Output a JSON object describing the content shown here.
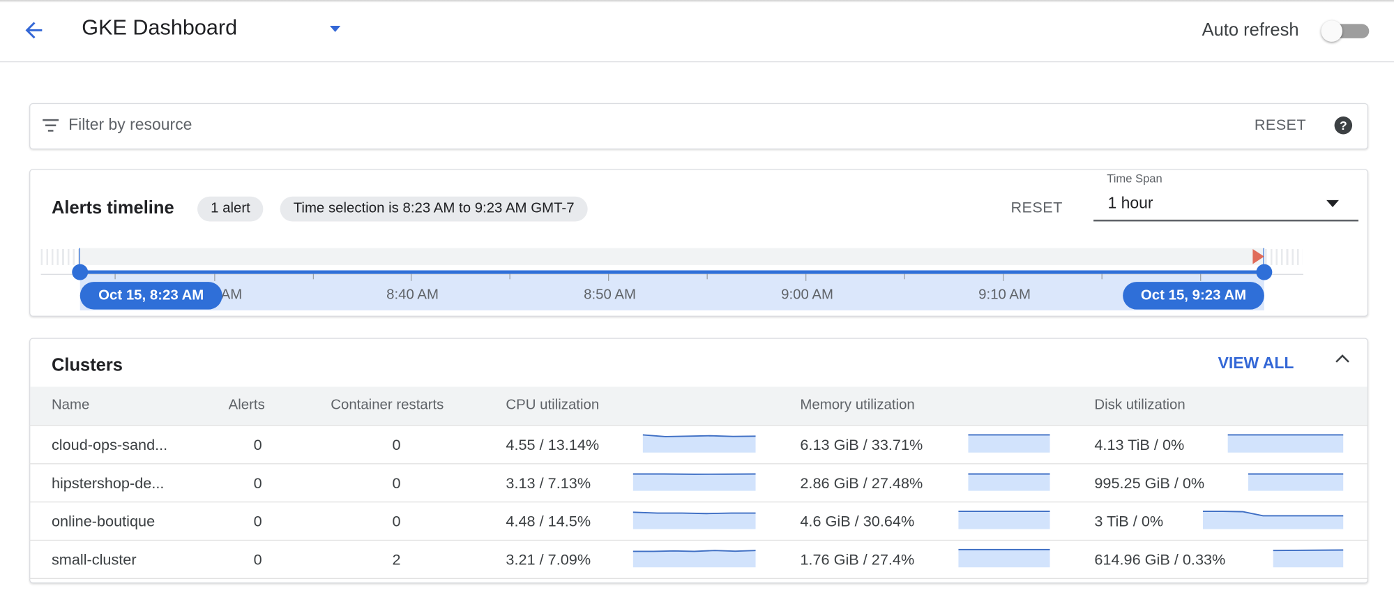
{
  "header": {
    "title": "GKE Dashboard",
    "auto_refresh_label": "Auto refresh",
    "auto_refresh_on": false
  },
  "filter": {
    "placeholder": "Filter by resource",
    "reset_label": "RESET",
    "icons": [
      "filter-icon",
      "help-icon"
    ]
  },
  "alerts_timeline": {
    "title": "Alerts timeline",
    "alert_count_chip": "1 alert",
    "time_selection_chip": "Time selection is 8:23 AM to 9:23 AM GMT-7",
    "reset_label": "RESET",
    "time_span": {
      "label": "Time Span",
      "value": "1 hour"
    },
    "axis_labels": [
      "8:30 AM",
      "8:40 AM",
      "8:50 AM",
      "9:00 AM",
      "9:10 AM"
    ],
    "start_handle": "Oct 15, 8:23 AM",
    "end_handle": "Oct 15, 9:23 AM",
    "colors": {
      "accent": "#2f6fd8",
      "alert_marker": "#e06c5a",
      "selection": "#dbe7fb"
    }
  },
  "clusters": {
    "title": "Clusters",
    "view_all_label": "VIEW ALL",
    "columns": [
      "Name",
      "Alerts",
      "Container restarts",
      "CPU utilization",
      "Memory utilization",
      "Disk utilization"
    ],
    "rows": [
      {
        "name": "cloud-ops-sand...",
        "alerts": "0",
        "restarts": "0",
        "cpu": "4.55 / 13.14%",
        "memory": "6.13 GiB / 33.71%",
        "disk": "4.13 TiB / 0%"
      },
      {
        "name": "hipstershop-de...",
        "alerts": "0",
        "restarts": "0",
        "cpu": "3.13 / 7.13%",
        "memory": "2.86 GiB / 27.48%",
        "disk": "995.25 GiB / 0%"
      },
      {
        "name": "online-boutique",
        "alerts": "0",
        "restarts": "0",
        "cpu": "4.48 / 14.5%",
        "memory": "4.6 GiB / 30.64%",
        "disk": "3 TiB / 0%"
      },
      {
        "name": "small-cluster",
        "alerts": "0",
        "restarts": "2",
        "cpu": "3.21 / 7.09%",
        "memory": "1.76 GiB / 27.4%",
        "disk": "614.96 GiB / 0.33%"
      }
    ]
  }
}
